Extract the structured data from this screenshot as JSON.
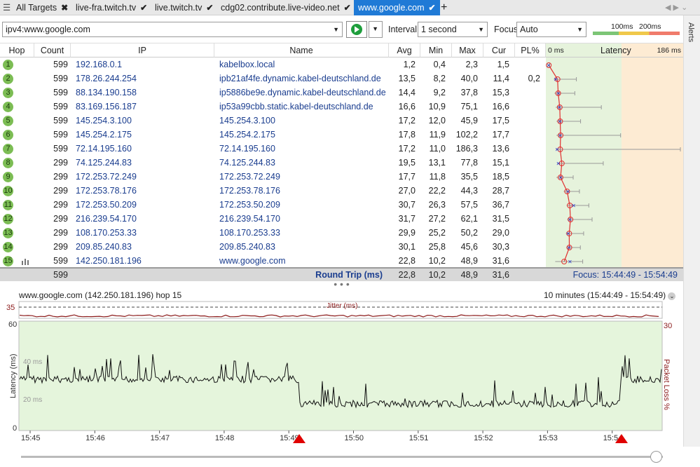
{
  "tabs": {
    "all": "All Targets",
    "items": [
      "live-fra.twitch.tv",
      "live.twitch.tv",
      "cdg02.contribute.live-video.net",
      "www.google.com"
    ],
    "add": "+"
  },
  "toolbar": {
    "target_value": "ipv4:www.google.com",
    "interval_label": "Interval",
    "interval_value": "1 second",
    "focus_label": "Focus",
    "focus_value": "Auto",
    "legend_100": "100ms",
    "legend_200": "200ms"
  },
  "alerts_label": "Alerts",
  "table": {
    "headers": {
      "hop": "Hop",
      "count": "Count",
      "ip": "IP",
      "name": "Name",
      "avg": "Avg",
      "min": "Min",
      "max": "Max",
      "cur": "Cur",
      "pl": "PL%",
      "lat_min": "0 ms",
      "latency": "Latency",
      "lat_max": "186 ms"
    },
    "rows": [
      {
        "hop": "1",
        "count": "599",
        "ip": "192.168.0.1",
        "name": "kabelbox.local",
        "avg": "1,2",
        "min": "0,4",
        "max": "2,3",
        "cur": "1,5",
        "pl": ""
      },
      {
        "hop": "2",
        "count": "599",
        "ip": "178.26.244.254",
        "name": "ipb21af4fe.dynamic.kabel-deutschland.de",
        "avg": "13,5",
        "min": "8,2",
        "max": "40,0",
        "cur": "11,4",
        "pl": "0,2"
      },
      {
        "hop": "3",
        "count": "599",
        "ip": "88.134.190.158",
        "name": "ip5886be9e.dynamic.kabel-deutschland.de",
        "avg": "14,4",
        "min": "9,2",
        "max": "37,8",
        "cur": "15,3",
        "pl": ""
      },
      {
        "hop": "4",
        "count": "599",
        "ip": "83.169.156.187",
        "name": "ip53a99cbb.static.kabel-deutschland.de",
        "avg": "16,6",
        "min": "10,9",
        "max": "75,1",
        "cur": "16,6",
        "pl": ""
      },
      {
        "hop": "5",
        "count": "599",
        "ip": "145.254.3.100",
        "name": "145.254.3.100",
        "avg": "17,2",
        "min": "12,0",
        "max": "45,9",
        "cur": "17,5",
        "pl": ""
      },
      {
        "hop": "6",
        "count": "599",
        "ip": "145.254.2.175",
        "name": "145.254.2.175",
        "avg": "17,8",
        "min": "11,9",
        "max": "102,2",
        "cur": "17,7",
        "pl": ""
      },
      {
        "hop": "7",
        "count": "599",
        "ip": "72.14.195.160",
        "name": "72.14.195.160",
        "avg": "17,2",
        "min": "11,0",
        "max": "186,3",
        "cur": "13,6",
        "pl": ""
      },
      {
        "hop": "8",
        "count": "299",
        "ip": "74.125.244.83",
        "name": "74.125.244.83",
        "avg": "19,5",
        "min": "13,1",
        "max": "77,8",
        "cur": "15,1",
        "pl": ""
      },
      {
        "hop": "9",
        "count": "299",
        "ip": "172.253.72.249",
        "name": "172.253.72.249",
        "avg": "17,7",
        "min": "11,8",
        "max": "35,5",
        "cur": "18,5",
        "pl": ""
      },
      {
        "hop": "10",
        "count": "299",
        "ip": "172.253.78.176",
        "name": "172.253.78.176",
        "avg": "27,0",
        "min": "22,2",
        "max": "44,3",
        "cur": "28,7",
        "pl": ""
      },
      {
        "hop": "11",
        "count": "299",
        "ip": "172.253.50.209",
        "name": "172.253.50.209",
        "avg": "30,7",
        "min": "26,3",
        "max": "57,5",
        "cur": "36,7",
        "pl": ""
      },
      {
        "hop": "12",
        "count": "299",
        "ip": "216.239.54.170",
        "name": "216.239.54.170",
        "avg": "31,7",
        "min": "27,2",
        "max": "62,1",
        "cur": "31,5",
        "pl": ""
      },
      {
        "hop": "13",
        "count": "299",
        "ip": "108.170.253.33",
        "name": "108.170.253.33",
        "avg": "29,9",
        "min": "25,2",
        "max": "50,2",
        "cur": "29,0",
        "pl": ""
      },
      {
        "hop": "14",
        "count": "299",
        "ip": "209.85.240.83",
        "name": "209.85.240.83",
        "avg": "30,1",
        "min": "25,8",
        "max": "45,6",
        "cur": "30,3",
        "pl": ""
      },
      {
        "hop": "15",
        "count": "599",
        "ip": "142.250.181.196",
        "name": "www.google.com",
        "avg": "22,8",
        "min": "10,2",
        "max": "48,9",
        "cur": "31,6",
        "pl": ""
      }
    ],
    "footer": {
      "count": "599",
      "label": "Round Trip (ms)",
      "avg": "22,8",
      "min": "10,2",
      "max": "48,9",
      "cur": "31,6",
      "focus": "Focus: 15:44:49 - 15:54:49"
    }
  },
  "graph": {
    "title": "www.google.com (142.250.181.196) hop 15",
    "range": "10 minutes (15:44:49 - 15:54:49)",
    "jitter_label": "Jitter (ms)",
    "jitter_max": "35",
    "lat_top": "60",
    "lat_bottom": "0",
    "pl_top": "30",
    "ylabel": "Latency (ms)",
    "y2label": "Packet Loss %",
    "ms40": "40 ms",
    "ms20": "20 ms",
    "times": [
      "15:45",
      "15:46",
      "15:47",
      "15:48",
      "15:49",
      "15:50",
      "15:51",
      "15:52",
      "15:53",
      "15:54"
    ]
  },
  "colors": {
    "accent": "#1f7ad6",
    "hop_green": "#7cbd54",
    "lat_green": "#e6f3dc",
    "lat_orange": "#fdebd3",
    "graph_bg": "#e5f5dc",
    "line_red": "#e03030"
  }
}
